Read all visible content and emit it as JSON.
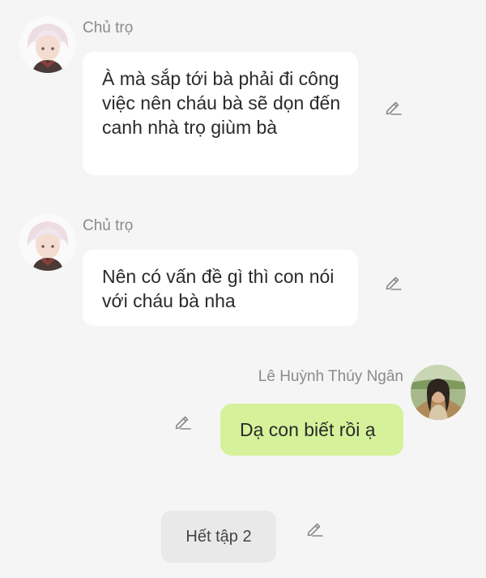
{
  "messages": [
    {
      "sender": "Chủ trọ",
      "text": "À mà sắp tới bà phải đi công việc nên cháu bà sẽ dọn đến canh nhà trọ giùm bà",
      "avatar_icon": "landlord-avatar"
    },
    {
      "sender": "Chủ trọ",
      "text": "Nên có vấn đề gì thì con nói với cháu bà nha",
      "avatar_icon": "landlord-avatar"
    },
    {
      "sender": "Lê Huỳnh Thúy Ngân",
      "text": "Dạ con biết rồi ạ",
      "avatar_icon": "user-photo-avatar"
    }
  ],
  "end_marker": {
    "label": "Hết tập 2"
  },
  "colors": {
    "background": "#f5f5f5",
    "bubble_other": "#ffffff",
    "bubble_mine": "#d5f29a",
    "sender_name": "#8a8a8a",
    "end_chip": "#e9e9e9"
  },
  "icons": {
    "edit": "pencil-icon"
  }
}
